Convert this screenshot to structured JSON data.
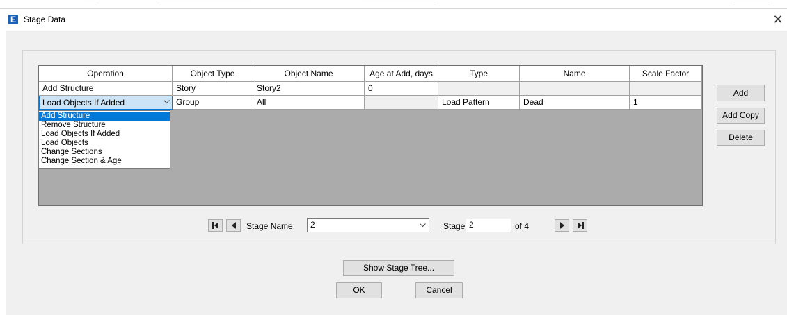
{
  "window": {
    "title": "Stage Data",
    "app_icon_letter": "E",
    "close_glyph": "✕"
  },
  "table": {
    "columns": [
      "Operation",
      "Object Type",
      "Object Name",
      "Age at Add, days",
      "Type",
      "Name",
      "Scale Factor"
    ],
    "rows": [
      [
        "Add Structure",
        "Story",
        "Story2",
        "0",
        "",
        "",
        ""
      ],
      [
        "Load Objects If Added",
        "Group",
        "All",
        "",
        "Load Pattern",
        "Dead",
        "1"
      ]
    ]
  },
  "operation_dropdown": {
    "options": [
      "Add Structure",
      "Remove Structure",
      "Load Objects If Added",
      "Load Objects",
      "Change Sections",
      "Change Section & Age"
    ],
    "highlighted": "Add Structure"
  },
  "side_buttons": {
    "add": "Add",
    "add_copy": "Add Copy",
    "delete": "Delete"
  },
  "navigation": {
    "stage_name_label": "Stage Name:",
    "stage_name_value": "2",
    "stage_label": "Stage:",
    "stage_value": "2",
    "of_label": "of 4"
  },
  "footer": {
    "show_stage_tree": "Show Stage Tree...",
    "ok": "OK",
    "cancel": "Cancel"
  },
  "icons": {
    "first": "first-record-icon",
    "prev": "previous-record-icon",
    "next": "next-record-icon",
    "last": "last-record-icon",
    "dropdown": "chevron-down-icon"
  },
  "colors": {
    "selection": "#0078d7",
    "selected_cell": "#cce4f7",
    "grid_empty": "#ababab",
    "dialog_bg": "#f0f0f0",
    "app_icon": "#1c62b9"
  }
}
